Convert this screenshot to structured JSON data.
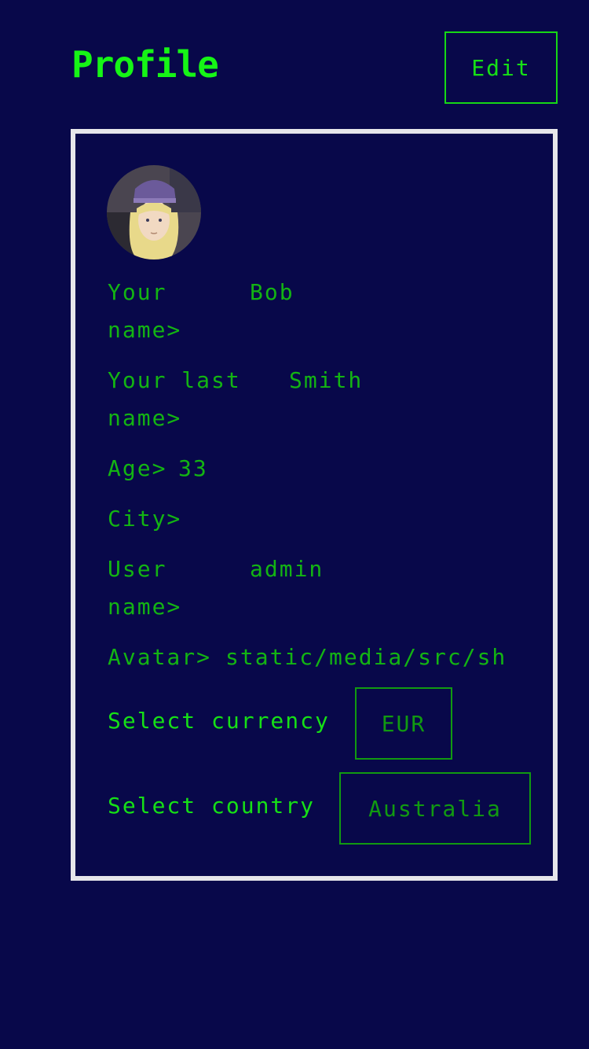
{
  "header": {
    "title": "Profile",
    "edit_label": "Edit"
  },
  "profile": {
    "avatar_icon": "user-avatar-image",
    "fields": {
      "first_name": {
        "label_line1": "Your",
        "label_line2": "name>",
        "value": "Bob"
      },
      "last_name": {
        "label_line1": "Your last",
        "label_line2": "name>",
        "value": "Smith"
      },
      "age": {
        "label": "Age>",
        "value": "33"
      },
      "city": {
        "label": "City>",
        "value": ""
      },
      "user_name": {
        "label_line1": "User",
        "label_line2": "name>",
        "value": "admin"
      },
      "avatar": {
        "label": "Avatar>",
        "value": "static/media/src/sh"
      }
    },
    "currency": {
      "label": "Select currency",
      "selected": "EUR"
    },
    "country": {
      "label": "Select country",
      "selected": "Australia"
    }
  },
  "colors": {
    "background": "#08084a",
    "accent": "#16f516",
    "text": "#13b413",
    "card_border": "#e6e6ea"
  }
}
